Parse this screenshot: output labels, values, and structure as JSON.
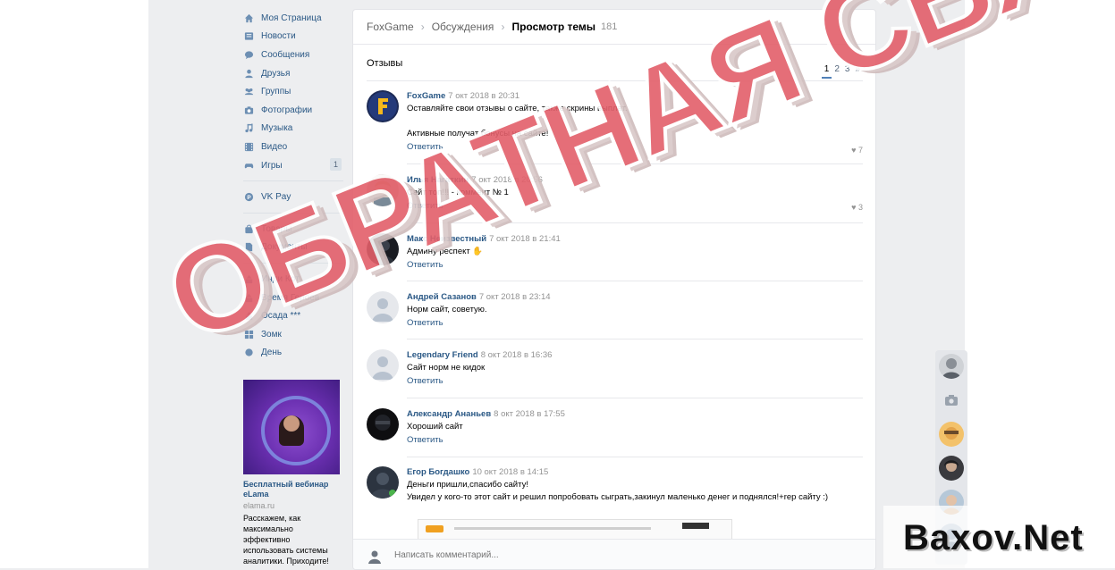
{
  "nav": {
    "items": [
      {
        "label": "Моя Страница",
        "icon": "home-icon"
      },
      {
        "label": "Новости",
        "icon": "news-icon"
      },
      {
        "label": "Сообщения",
        "icon": "messages-icon"
      },
      {
        "label": "Друзья",
        "icon": "friends-icon"
      },
      {
        "label": "Группы",
        "icon": "groups-icon"
      },
      {
        "label": "Фотографии",
        "icon": "camera-icon"
      },
      {
        "label": "Музыка",
        "icon": "music-icon"
      },
      {
        "label": "Видео",
        "icon": "video-icon"
      },
      {
        "label": "Игры",
        "icon": "gamepad-icon",
        "badge": "1"
      }
    ],
    "vkpay": "VK Pay",
    "goods": "Товары",
    "documents": "Документы",
    "apps": [
      "Инди Кот",
      "Время Героев",
      "Осада ***",
      "Зомк",
      "День"
    ]
  },
  "ad": {
    "title": "Бесплатный вебинар eLama",
    "domain": "elama.ru",
    "text": "Расскажем, как максимально эффективно использовать системы аналитики. Приходите!"
  },
  "breadcrumb": {
    "group": "FoxGame",
    "section": "Обсуждения",
    "current": "Просмотр темы",
    "count": "181"
  },
  "topic": {
    "title": "Отзывы"
  },
  "pager": {
    "pages": [
      "1",
      "2",
      "3",
      "»"
    ]
  },
  "comments": [
    {
      "author": "FoxGame",
      "date": "7 окт 2018 в 20:31",
      "text": "Оставляйте свои отзывы о сайте, также скрины выплат.",
      "text2": "Активные получат бонусы на сайте!",
      "reply": "Ответить",
      "likes": "7"
    },
    {
      "author": "Илья Нагаткин",
      "date": "7 окт 2018 в 20:56",
      "text": "Сайт топ!!! - коммент № 1",
      "reply": "Ответить",
      "likes": "3"
    },
    {
      "author": "Макс Неизвестный",
      "date": "7 окт 2018 в 21:41",
      "text": "Админу респект",
      "reply": "Ответить"
    },
    {
      "author": "Андрей Сазанов",
      "date": "7 окт 2018 в 23:14",
      "text": "Норм сайт, советую.",
      "reply": "Ответить"
    },
    {
      "author": "Legendary Friend",
      "date": "8 окт 2018 в 16:36",
      "text": "Сайт норм не кидок",
      "reply": "Ответить"
    },
    {
      "author": "Александр Ананьев",
      "date": "8 окт 2018 в 17:55",
      "text": "Хороший сайт",
      "reply": "Ответить"
    },
    {
      "author": "Егор Богдашко",
      "date": "10 окт 2018 в 14:15",
      "text": "Деньги пришли,спасибо сайту!",
      "text2": "Увидел у кого-то этот сайт и решил попробовать сыграть,закинул маленько денег и поднялся!+rep сайту :)"
    }
  ],
  "composer": {
    "placeholder": "Написать комментарий..."
  },
  "watermark": {
    "main": "ОБРАТНАЯ СВЯЗЬ",
    "corner": "Baxov.Net"
  },
  "colors": {
    "link": "#2a5885",
    "accent": "#5181b8",
    "watermark": "#e35f6a"
  }
}
